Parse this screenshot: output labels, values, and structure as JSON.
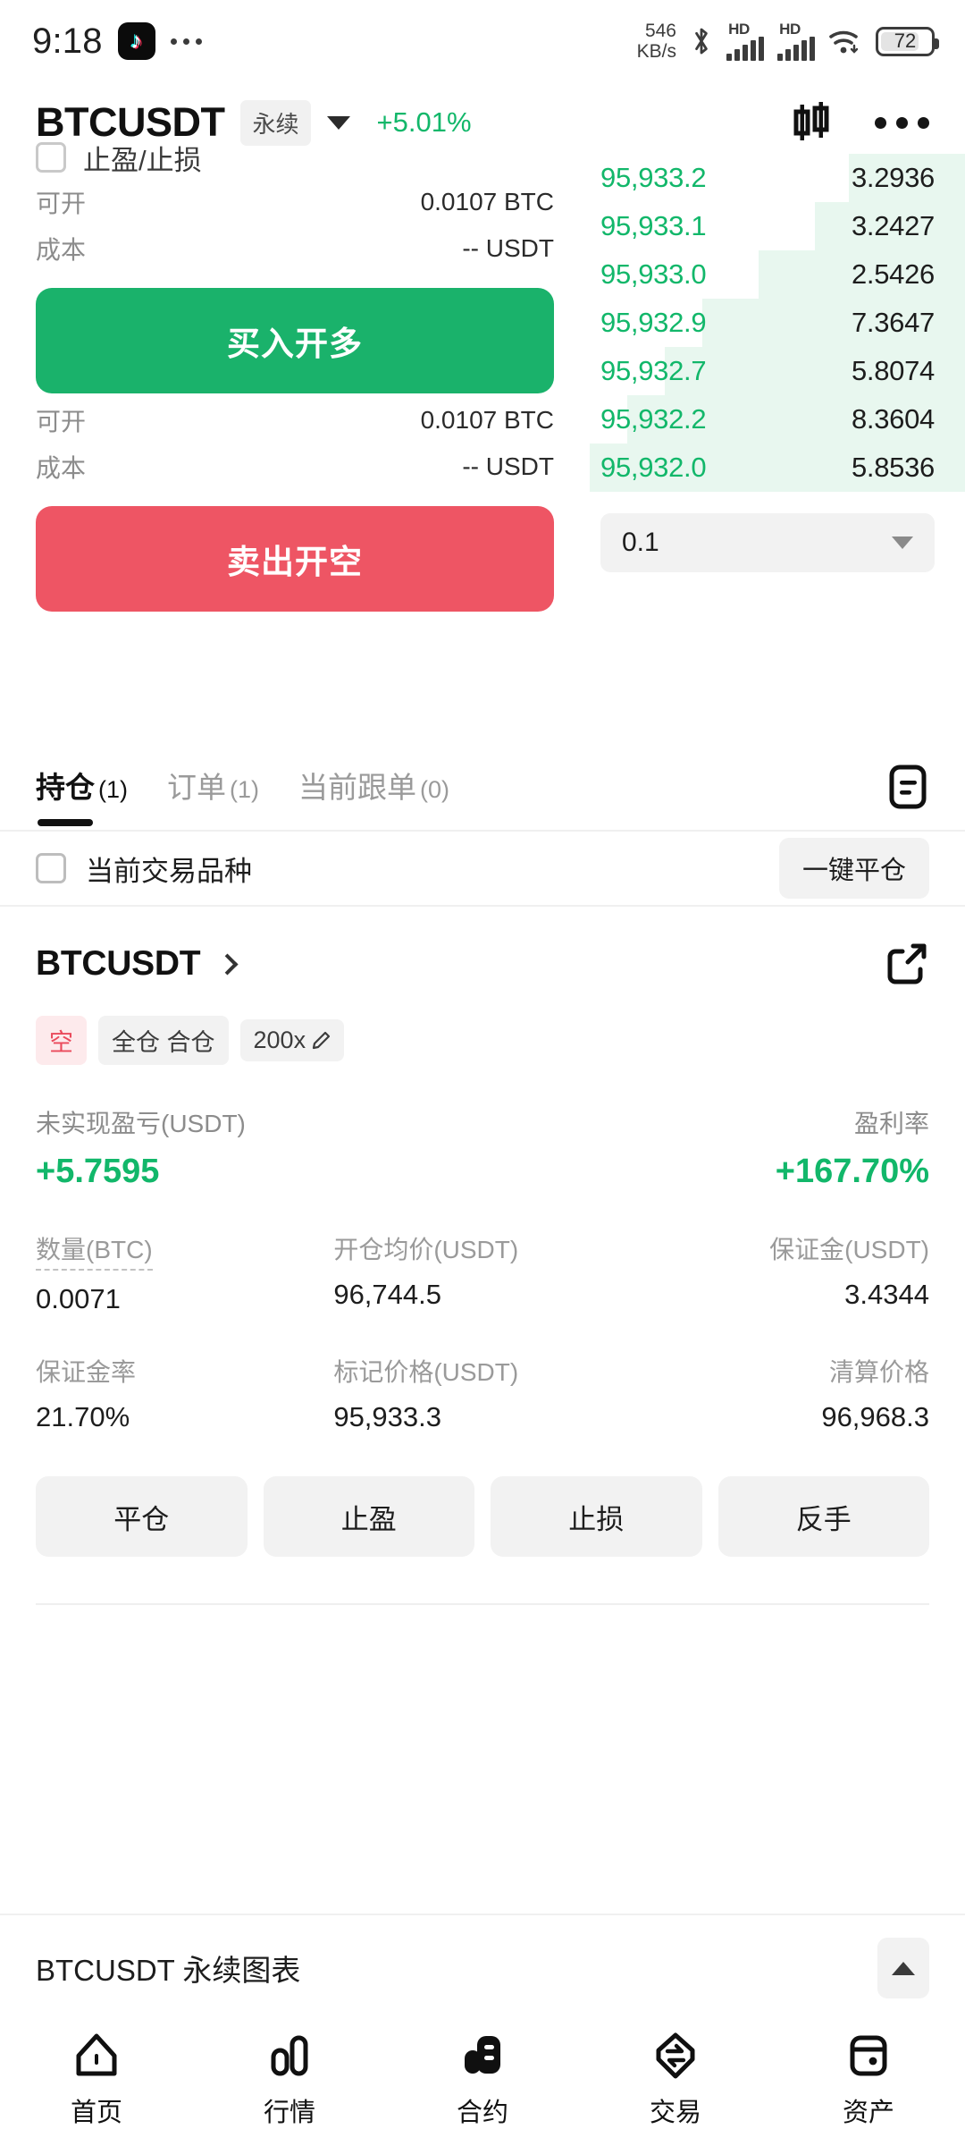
{
  "status_bar": {
    "time": "9:18",
    "app_icon": "tiktok-icon",
    "overflow_icon": "more-dots-icon",
    "net_speed_value": "546",
    "net_speed_unit": "KB/s",
    "bluetooth_icon": "bluetooth-icon",
    "sim1_label": "HD",
    "sim2_label": "HD",
    "wifi_icon": "wifi-icon",
    "battery_percent": "72"
  },
  "header": {
    "symbol": "BTCUSDT",
    "contract_badge": "永续",
    "dropdown_icon": "chevron-down-icon",
    "change_percent": "+5.01%",
    "chart_icon": "candlestick-chart-icon",
    "more_icon": "more-options-icon"
  },
  "order_panel": {
    "tpsl_label": "止盈/止损",
    "long": {
      "available_label": "可开",
      "available_value": "0.0107 BTC",
      "cost_label": "成本",
      "cost_value": "-- USDT",
      "button_label": "买入开多"
    },
    "short": {
      "available_label": "可开",
      "available_value": "0.0107 BTC",
      "cost_label": "成本",
      "cost_value": "-- USDT",
      "button_label": "卖出开空"
    }
  },
  "order_book": {
    "tick_size": "0.1",
    "tick_dropdown_icon": "chevron-down-icon",
    "asks": [
      {
        "price": "95,933.2",
        "amount": "3.2936",
        "depth_pct": 31
      },
      {
        "price": "95,933.1",
        "amount": "3.2427",
        "depth_pct": 40
      },
      {
        "price": "95,933.0",
        "amount": "2.5426",
        "depth_pct": 55
      },
      {
        "price": "95,932.9",
        "amount": "7.3647",
        "depth_pct": 70
      },
      {
        "price": "95,932.7",
        "amount": "5.8074",
        "depth_pct": 80
      },
      {
        "price": "95,932.2",
        "amount": "8.3604",
        "depth_pct": 90
      },
      {
        "price": "95,932.0",
        "amount": "5.8536",
        "depth_pct": 100
      }
    ]
  },
  "tabs": [
    {
      "label": "持仓",
      "count": "(1)",
      "active": true
    },
    {
      "label": "订单",
      "count": "(1)",
      "active": false
    },
    {
      "label": "当前跟单",
      "count": "(0)",
      "active": false
    }
  ],
  "tabs_menu_icon": "list-view-icon",
  "filter_row": {
    "checkbox_label": "当前交易品种",
    "close_all_label": "一键平仓"
  },
  "position": {
    "symbol": "BTCUSDT",
    "expand_icon": "chevron-right-icon",
    "share_icon": "share-external-icon",
    "tags": {
      "side": "空",
      "mode": "全仓 合仓",
      "leverage": "200x",
      "leverage_edit_icon": "pencil-edit-icon"
    },
    "pnl": {
      "label": "未实现盈亏(USDT)",
      "value": "+5.7595",
      "roe_label": "盈利率",
      "roe_value": "+167.70%"
    },
    "stats": [
      {
        "label": "数量(BTC)",
        "value": "0.0071",
        "dashed": true
      },
      {
        "label": "开仓均价(USDT)",
        "value": "96,744.5",
        "dashed": false
      },
      {
        "label": "保证金(USDT)",
        "value": "3.4344",
        "dashed": false
      },
      {
        "label": "保证金率",
        "value": "21.70%",
        "dashed": false
      },
      {
        "label": "标记价格(USDT)",
        "value": "95,933.3",
        "dashed": false
      },
      {
        "label": "清算价格",
        "value": "96,968.3",
        "dashed": false
      }
    ],
    "actions": [
      "平仓",
      "止盈",
      "止损",
      "反手"
    ]
  },
  "chart_bar": {
    "title": "BTCUSDT 永续图表",
    "toggle_icon": "chevron-up-icon"
  },
  "bottom_nav": [
    {
      "label": "首页",
      "icon": "home-icon",
      "active": false
    },
    {
      "label": "行情",
      "icon": "markets-bars-icon",
      "active": false
    },
    {
      "label": "合约",
      "icon": "futures-contract-icon",
      "active": true
    },
    {
      "label": "交易",
      "icon": "exchange-swap-icon",
      "active": false
    },
    {
      "label": "资产",
      "icon": "wallet-assets-icon",
      "active": false
    }
  ],
  "colors": {
    "up_green": "#12b76a",
    "buy_green": "#1ab26b",
    "sell_red": "#ee5564",
    "short_tag_red": "#ea4a5c",
    "depth_green": "#e8f7ef"
  }
}
